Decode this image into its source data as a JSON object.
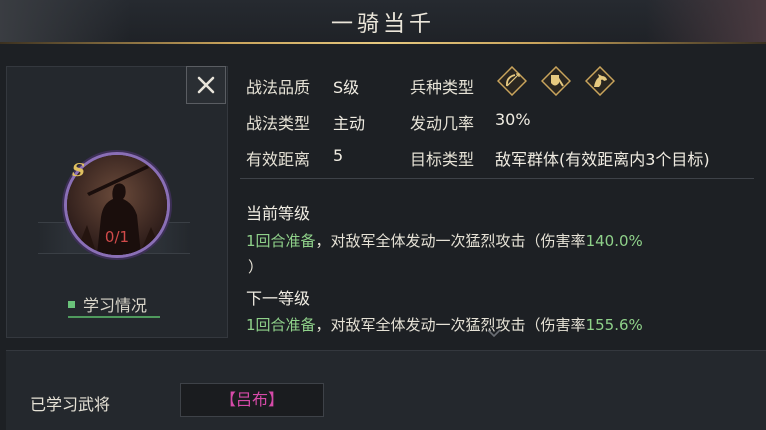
{
  "title": "一骑当千",
  "skill": {
    "quality_label": "战法品质",
    "quality_value": "S级",
    "troop_label": "兵种类型",
    "troop_icons": [
      "archer-icon",
      "shield-infantry-icon",
      "cavalry-icon"
    ],
    "type_label": "战法类型",
    "type_value": "主动",
    "rate_label": "发动几率",
    "rate_value": "30%",
    "range_label": "有效距离",
    "range_value": "5",
    "target_label": "目标类型",
    "target_value": "敌军群体(有效距离内3个目标)"
  },
  "levels": {
    "current_label": "当前等级",
    "current_desc_prefix": "1回合准备",
    "current_desc_mid": "，对敌军全体发动一次猛烈攻击（伤害率",
    "current_desc_value": "140.0%",
    "current_desc_suffix": "）",
    "next_label": "下一等级",
    "next_desc_prefix": "1回合准备",
    "next_desc_mid": "，对敌军全体发动一次猛烈攻击（伤害率",
    "next_desc_value": "155.6%"
  },
  "card": {
    "grade": "S",
    "count": "0/1",
    "study_label": "学习情况"
  },
  "learned": {
    "label": "已学习武将",
    "general": "【吕布】"
  },
  "colors": {
    "gold": "#c9a45c",
    "green": "#8fd18a",
    "purple_ring": "#8a6fb6",
    "count_red": "#d14a4a",
    "general_pink": "#d54aa8"
  }
}
